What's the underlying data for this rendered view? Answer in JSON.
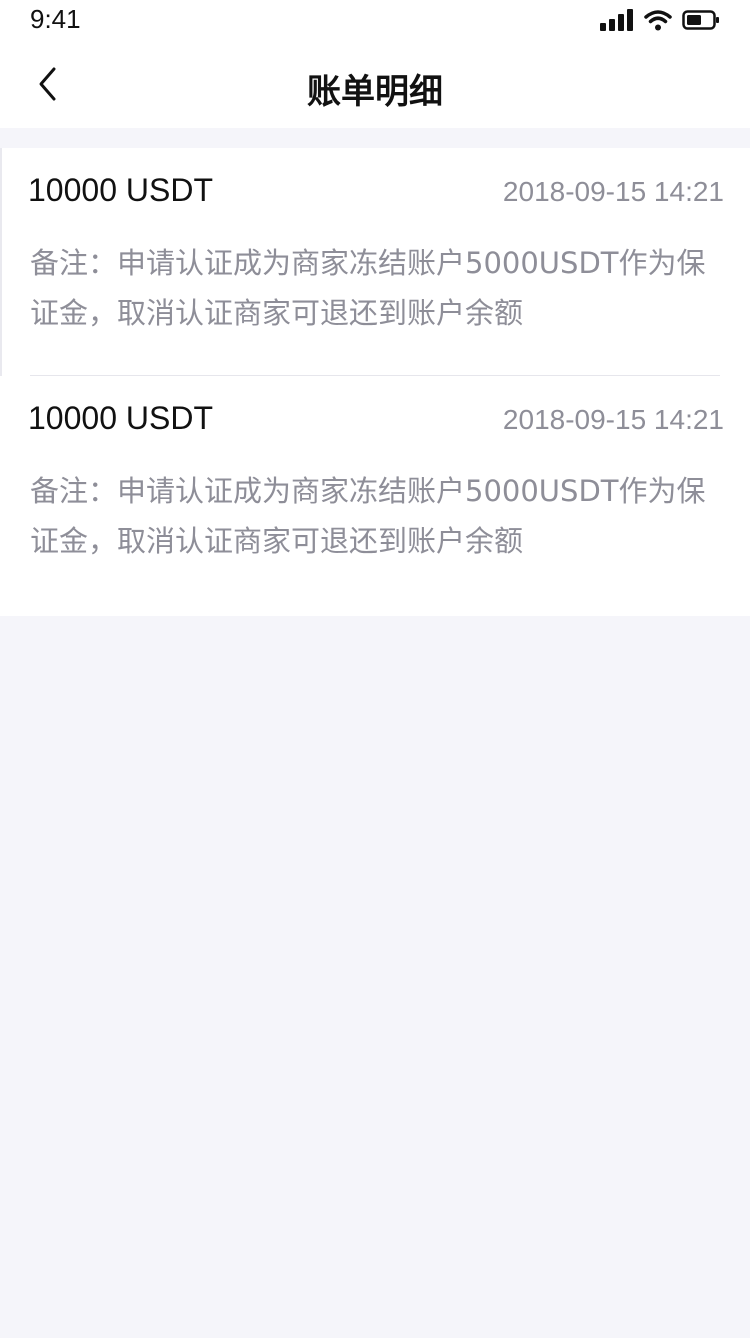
{
  "status_bar": {
    "time": "9:41",
    "icons": [
      "signal-icon",
      "wifi-icon",
      "battery-icon"
    ]
  },
  "nav": {
    "title": "账单明细",
    "back_icon": "chevron-left-icon"
  },
  "records": [
    {
      "amount": "10000 USDT",
      "time": "2018-09-15 14:21",
      "note": "备注：申请认证成为商家冻结账户5000USDT作为保证金，取消认证商家可退还到账户余额"
    },
    {
      "amount": "10000 USDT",
      "time": "2018-09-15 14:21",
      "note": "备注：申请认证成为商家冻结账户5000USDT作为保证金，取消认证商家可退还到账户余额"
    }
  ],
  "colors": {
    "background": "#f5f5fa",
    "card": "#ffffff",
    "primary_text": "#111111",
    "secondary_text": "#8e8e98",
    "divider": "#e6e6ec"
  }
}
